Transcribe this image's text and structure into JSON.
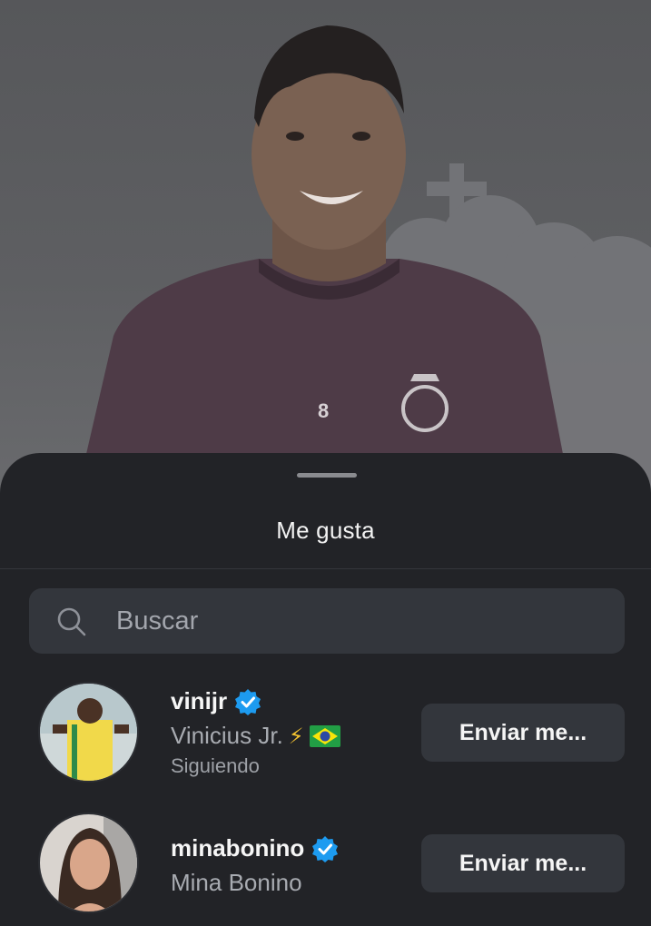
{
  "background": {
    "jersey_number": "8"
  },
  "sheet": {
    "title": "Me gusta"
  },
  "search": {
    "placeholder": "Buscar",
    "value": ""
  },
  "users": [
    {
      "username": "vinijr",
      "full_name": "Vinicius Jr.",
      "name_emoji": "⚡",
      "status": "Siguiendo",
      "verified": true,
      "button_label": "Enviar me..."
    },
    {
      "username": "minabonino",
      "full_name": "Mina Bonino",
      "verified": true,
      "button_label": "Enviar me..."
    }
  ],
  "colors": {
    "sheet_bg": "#222327",
    "field_bg": "#33363c",
    "verified_blue": "#1d9bf0"
  },
  "icons": {
    "search": "search-icon",
    "verified": "verified-badge-icon",
    "flag": "brazil-flag-icon"
  }
}
